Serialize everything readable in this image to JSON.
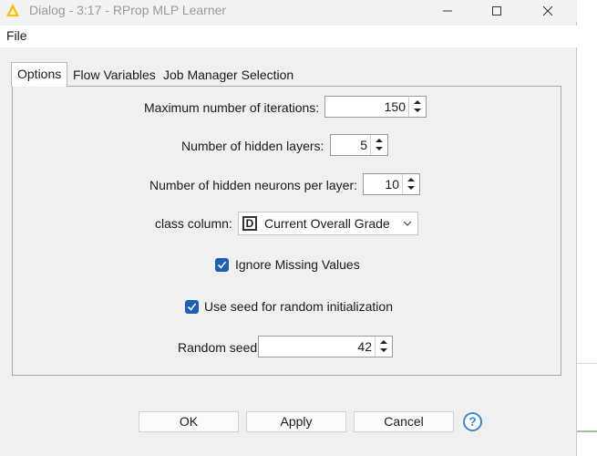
{
  "window": {
    "title": "Dialog - 3:17 - RProp MLP Learner",
    "controls": {
      "minimize": "minimize-icon",
      "maximize": "maximize-icon",
      "close": "close-icon"
    }
  },
  "menubar": {
    "file": "File"
  },
  "tabs": [
    {
      "label": "Options",
      "active": true
    },
    {
      "label": "Flow Variables",
      "active": false
    },
    {
      "label": "Job Manager Selection",
      "active": false
    }
  ],
  "options": {
    "max_iterations": {
      "label": "Maximum number of iterations:",
      "value": "150"
    },
    "hidden_layers": {
      "label": "Number of hidden layers:",
      "value": "5"
    },
    "hidden_neurons": {
      "label": "Number of hidden neurons per layer:",
      "value": "10"
    },
    "class_column": {
      "label": "class column:",
      "type_icon": "D",
      "value": "Current Overall Grade"
    },
    "ignore_missing": {
      "label": "Ignore Missing Values",
      "checked": true
    },
    "use_seed": {
      "label": "Use seed for random initialization",
      "checked": true
    },
    "random_seed": {
      "label": "Random seed",
      "value": "42"
    }
  },
  "buttons": {
    "ok": "OK",
    "apply": "Apply",
    "cancel": "Cancel",
    "help": "?"
  },
  "colors": {
    "accent": "#1d5fb4",
    "help": "#3b87d6",
    "app_icon": "#f5c211"
  }
}
